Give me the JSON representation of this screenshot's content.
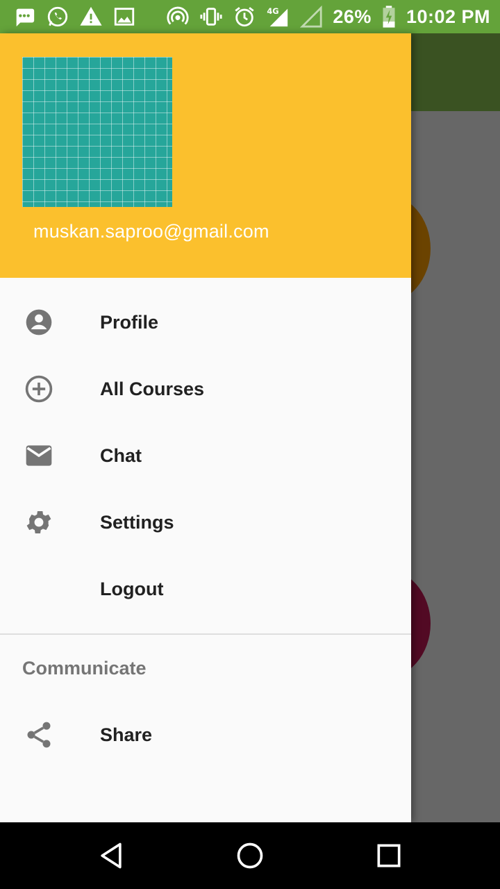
{
  "status_bar": {
    "battery": "26%",
    "time": "10:02 PM",
    "network": "4G",
    "icons": [
      "chat-bubble-icon",
      "whatsapp-icon",
      "warning-icon",
      "image-icon",
      "hotspot-icon",
      "vibrate-icon",
      "alarm-icon",
      "signal-4g-icon",
      "signal-icon",
      "battery-charging-icon"
    ]
  },
  "drawer": {
    "user_email": "muskan.saproo@gmail.com",
    "items": [
      {
        "label": "Profile",
        "icon": "account-circle-icon"
      },
      {
        "label": "All Courses",
        "icon": "add-circle-icon"
      },
      {
        "label": "Chat",
        "icon": "mail-icon"
      },
      {
        "label": "Settings",
        "icon": "gear-icon"
      },
      {
        "label": "Logout",
        "icon": ""
      }
    ],
    "section_title": "Communicate",
    "section_items": [
      {
        "label": "Share",
        "icon": "share-icon"
      }
    ]
  },
  "nav_bar": {
    "buttons": [
      "back-icon",
      "home-icon",
      "recents-icon"
    ]
  },
  "colors": {
    "status_bar": "#64a33a",
    "header": "#fbc02d",
    "avatar": "#26a69a",
    "scrim": "#676767",
    "toolbar_dim": "#3a5222"
  }
}
